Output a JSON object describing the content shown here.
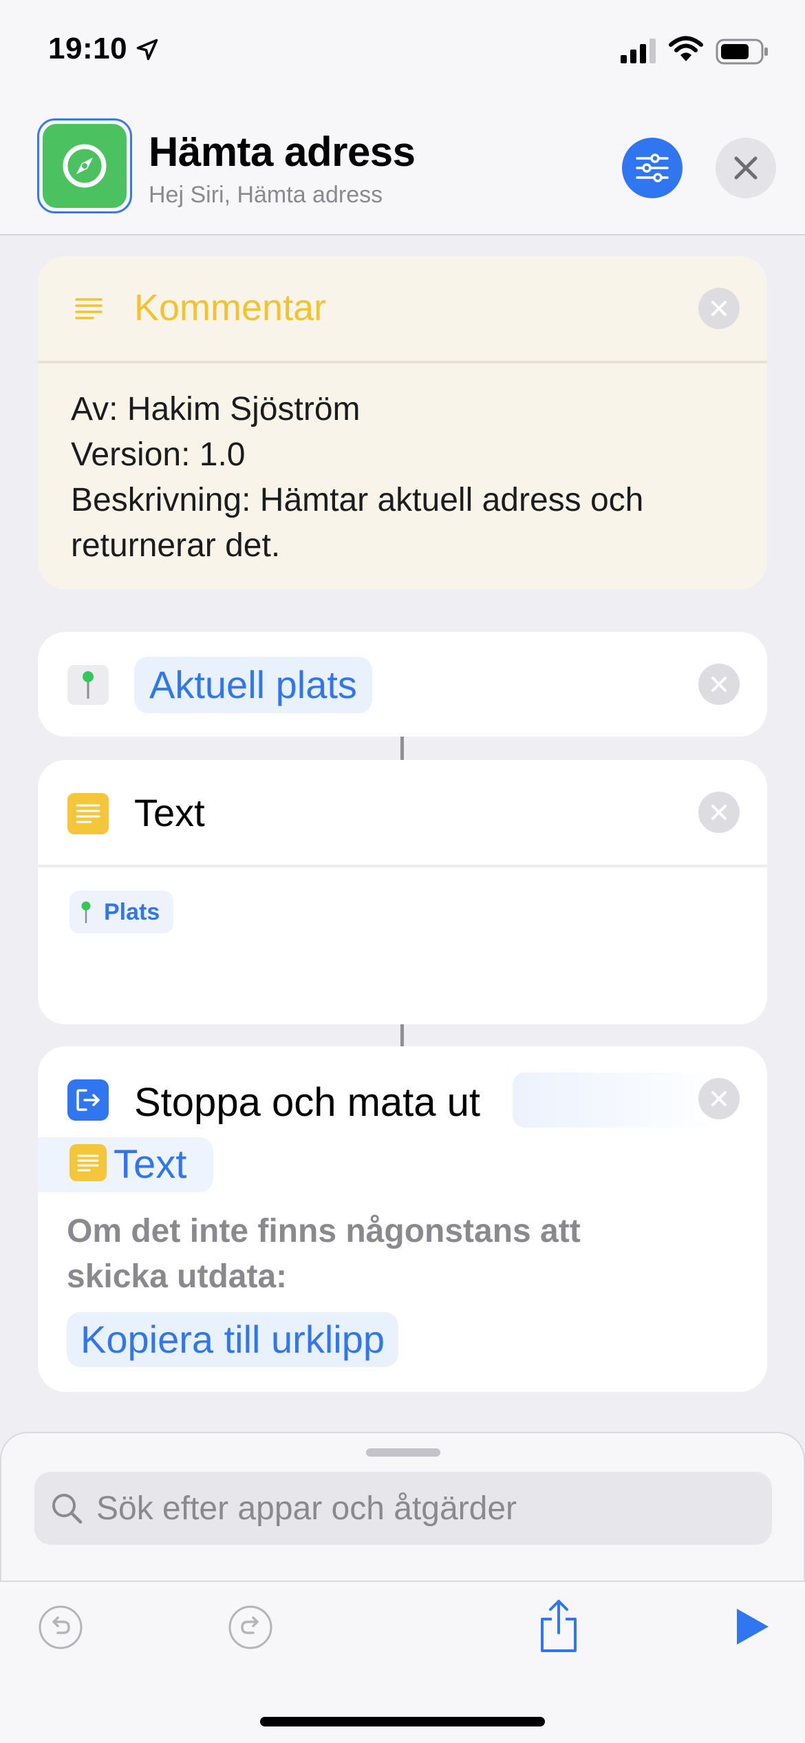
{
  "status_bar": {
    "time": "19:10"
  },
  "header": {
    "title": "Hämta adress",
    "subtitle": "Hej Siri, Hämta adress"
  },
  "comment": {
    "title": "Kommentar",
    "lines": [
      "Av: Hakim Sjöström",
      "Version: 1.0",
      "Beskrivning: Hämtar aktuell adress och",
      "returnerar det."
    ]
  },
  "location_action": {
    "token": "Aktuell plats"
  },
  "text_action": {
    "title": "Text",
    "variable": "Plats"
  },
  "stop_action": {
    "title": "Stoppa och mata ut",
    "variable": "Text",
    "note": "Om det inte finns någonstans att skicka utdata:",
    "fallback": "Kopiera till urklipp"
  },
  "search": {
    "placeholder": "Sök efter appar och åtgärder"
  },
  "colors": {
    "accent": "#2f76f0",
    "comment_bg": "#f8f4e9",
    "comment_title": "#f1c232",
    "app_icon": "#4cc15f",
    "text_icon": "#f5c53a"
  },
  "icons": {
    "app": "compass-icon",
    "settings": "sliders-icon",
    "close": "close-icon",
    "comment": "lines-icon",
    "location": "pin-icon",
    "text": "text-lines-icon",
    "stop": "exit-icon",
    "search": "search-icon",
    "undo": "undo-icon",
    "redo": "redo-icon",
    "share": "share-icon",
    "run": "play-icon"
  }
}
